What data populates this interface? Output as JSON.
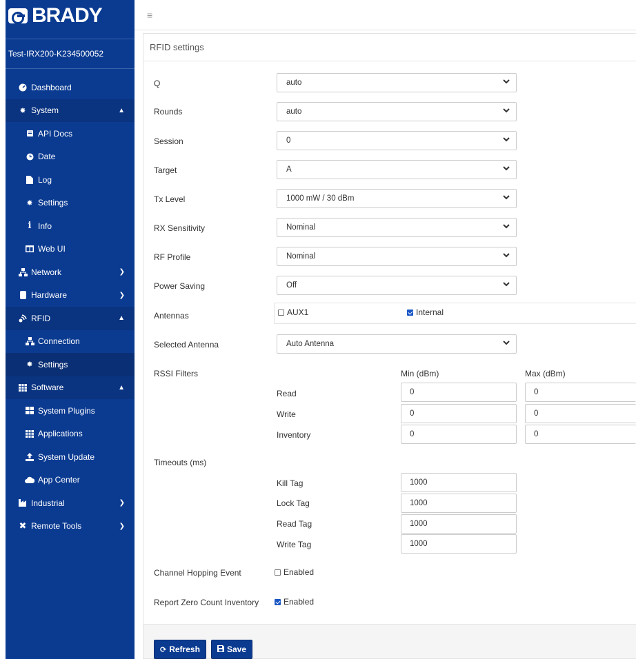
{
  "brand": {
    "logo_text": "BRADY"
  },
  "device_name": "Test-IRX200-K234500052",
  "sidebar": {
    "items": [
      {
        "label": "Dashboard",
        "icon": "tachometer-icon",
        "level": "top"
      },
      {
        "label": "System",
        "icon": "gear-icon",
        "level": "top",
        "expanded": true
      },
      {
        "label": "API Docs",
        "icon": "book-icon",
        "level": "sub"
      },
      {
        "label": "Date",
        "icon": "clock-icon",
        "level": "sub"
      },
      {
        "label": "Log",
        "icon": "file-icon",
        "level": "sub"
      },
      {
        "label": "Settings",
        "icon": "gear-icon",
        "level": "sub"
      },
      {
        "label": "Info",
        "icon": "info-icon",
        "level": "sub"
      },
      {
        "label": "Web UI",
        "icon": "columns-icon",
        "level": "sub"
      },
      {
        "label": "Network",
        "icon": "network-icon",
        "level": "top",
        "expanded": false
      },
      {
        "label": "Hardware",
        "icon": "hdd-icon",
        "level": "top",
        "expanded": false
      },
      {
        "label": "RFID",
        "icon": "rfid-icon",
        "level": "top",
        "expanded": true
      },
      {
        "label": "Connection",
        "icon": "network-icon",
        "level": "sub"
      },
      {
        "label": "Settings",
        "icon": "gear-icon",
        "level": "sub",
        "active": true
      },
      {
        "label": "Software",
        "icon": "grid-icon",
        "level": "top",
        "expanded": true
      },
      {
        "label": "System Plugins",
        "icon": "grid-icon",
        "level": "sub"
      },
      {
        "label": "Applications",
        "icon": "grid-icon",
        "level": "sub"
      },
      {
        "label": "System Update",
        "icon": "upload-icon",
        "level": "sub"
      },
      {
        "label": "App Center",
        "icon": "cloud-icon",
        "level": "sub"
      },
      {
        "label": "Industrial",
        "icon": "industry-icon",
        "level": "top",
        "expanded": false
      },
      {
        "label": "Remote Tools",
        "icon": "tools-icon",
        "level": "top",
        "expanded": false
      }
    ]
  },
  "page": {
    "title": "RFID settings"
  },
  "form": {
    "q": {
      "label": "Q",
      "value": "auto"
    },
    "rounds": {
      "label": "Rounds",
      "value": "auto"
    },
    "session": {
      "label": "Session",
      "value": "0"
    },
    "target": {
      "label": "Target",
      "value": "A"
    },
    "tx_level": {
      "label": "Tx Level",
      "value": "1000 mW / 30 dBm"
    },
    "rx_sensitivity": {
      "label": "RX Sensitivity",
      "value": "Nominal"
    },
    "rf_profile": {
      "label": "RF Profile",
      "value": "Nominal"
    },
    "power_saving": {
      "label": "Power Saving",
      "value": "Off"
    },
    "antennas": {
      "label": "Antennas",
      "aux1": {
        "label": "AUX1",
        "checked": false
      },
      "internal": {
        "label": "Internal",
        "checked": true
      }
    },
    "selected_antenna": {
      "label": "Selected Antenna",
      "value": "Auto Antenna"
    },
    "rssi": {
      "label": "RSSI Filters",
      "min_header": "Min (dBm)",
      "max_header": "Max (dBm)",
      "rows": [
        {
          "label": "Read",
          "min": "0",
          "max": "0"
        },
        {
          "label": "Write",
          "min": "0",
          "max": "0"
        },
        {
          "label": "Inventory",
          "min": "0",
          "max": "0"
        }
      ]
    },
    "timeouts": {
      "label": "Timeouts (ms)",
      "rows": [
        {
          "label": "Kill Tag",
          "value": "1000"
        },
        {
          "label": "Lock Tag",
          "value": "1000"
        },
        {
          "label": "Read Tag",
          "value": "1000"
        },
        {
          "label": "Write Tag",
          "value": "1000"
        }
      ]
    },
    "channel_hopping": {
      "label": "Channel Hopping Event",
      "check_label": "Enabled",
      "checked": false
    },
    "report_zero": {
      "label": "Report Zero Count Inventory",
      "check_label": "Enabled",
      "checked": true
    }
  },
  "buttons": {
    "refresh": "Refresh",
    "save": "Save"
  },
  "colors": {
    "sidebar": "#0b3b91",
    "accent": "#1a56c4"
  }
}
